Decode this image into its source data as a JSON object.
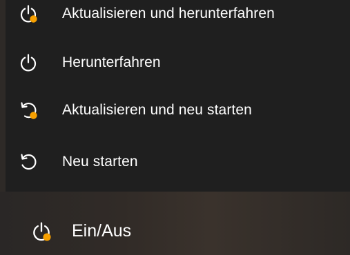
{
  "menu": {
    "items": [
      {
        "label": "Aktualisieren und herunterfahren",
        "icon": "power-update-icon"
      },
      {
        "label": "Herunterfahren",
        "icon": "power-icon"
      },
      {
        "label": "Aktualisieren und neu starten",
        "icon": "restart-update-icon"
      },
      {
        "label": "Neu starten",
        "icon": "restart-icon"
      }
    ]
  },
  "power_button": {
    "label": "Ein/Aus",
    "icon": "power-update-icon"
  },
  "colors": {
    "menu_background": "#1f1f1f",
    "text": "#ffffff",
    "update_badge": "#f7a000"
  }
}
